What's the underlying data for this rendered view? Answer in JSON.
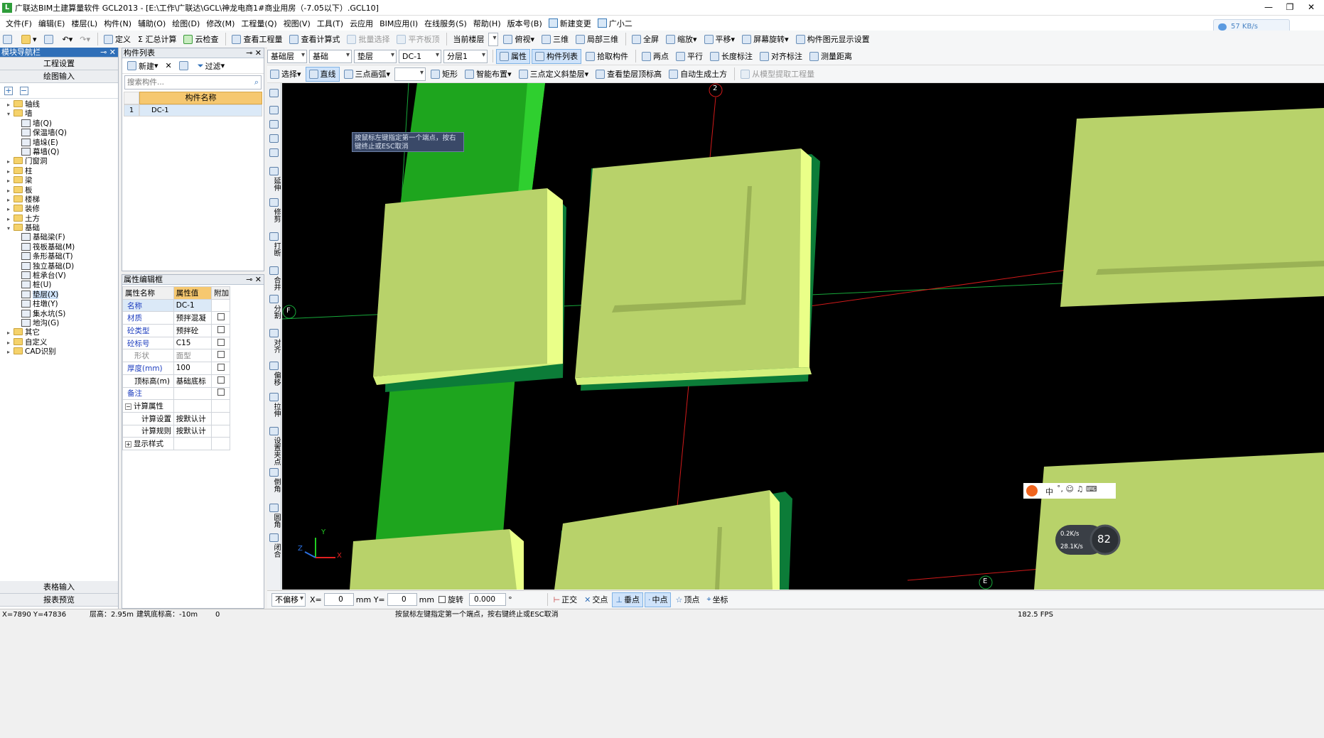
{
  "title": "广联达BIM土建算量软件 GCL2013 - [E:\\工作\\广联达\\GCL\\神龙电商1#商业用房（-7.05以下）.GCL10]",
  "menu": [
    "文件(F)",
    "编辑(E)",
    "楼层(L)",
    "构件(N)",
    "辅助(O)",
    "绘图(D)",
    "修改(M)",
    "工程量(Q)",
    "视图(V)",
    "工具(T)",
    "云应用",
    "BIM应用(I)",
    "在线服务(S)",
    "帮助(H)",
    "版本号(B)",
    "新建变更",
    "广小二"
  ],
  "net_speed": "57 KB/s",
  "toolbar1": {
    "define": "定义",
    "summary": "Σ 汇总计算",
    "cloud_check": "云检查",
    "view_qty": "查看工程量",
    "view_formula": "查看计算式",
    "batch_select": "批量选择",
    "level_slab": "平齐板顶",
    "current_floor": "当前楼层",
    "top_view": "俯视",
    "three_d": "三维",
    "local_3d": "局部三维",
    "fullscreen": "全屏",
    "zoom": "缩放",
    "pan": "平移",
    "rotate": "屏幕旋转",
    "display_settings": "构件图元显示设置"
  },
  "toolbar2": {
    "floor": "基础层",
    "category": "基础",
    "type": "垫层",
    "component": "DC-1",
    "layer": "分层1",
    "attributes": "属性",
    "comp_list": "构件列表",
    "pick": "拾取构件",
    "two_points": "两点",
    "parallel": "平行",
    "length_dim": "长度标注",
    "align_dim": "对齐标注",
    "measure": "测量距离"
  },
  "toolbar3": {
    "select": "选择",
    "line": "直线",
    "arc": "三点画弧",
    "rect": "矩形",
    "smart": "智能布置",
    "slope": "三点定义斜垫层",
    "view_elev": "查看垫层顶标高",
    "auto_earth": "自动生成土方",
    "from_model": "从模型提取工程量"
  },
  "nav": {
    "title": "模块导航栏",
    "project_settings": "工程设置",
    "drawing_input": "绘图输入",
    "table_input": "表格输入",
    "report_preview": "报表预览",
    "tree": [
      {
        "label": "轴线",
        "level": 0,
        "exp": "+",
        "kind": "fold"
      },
      {
        "label": "墙",
        "level": 0,
        "exp": "−",
        "kind": "fold"
      },
      {
        "label": "墙(Q)",
        "level": 1,
        "kind": "comp"
      },
      {
        "label": "保温墙(Q)",
        "level": 1,
        "kind": "comp"
      },
      {
        "label": "墙垛(E)",
        "level": 1,
        "kind": "comp"
      },
      {
        "label": "幕墙(Q)",
        "level": 1,
        "kind": "comp"
      },
      {
        "label": "门窗洞",
        "level": 0,
        "exp": "+",
        "kind": "fold"
      },
      {
        "label": "柱",
        "level": 0,
        "exp": "+",
        "kind": "fold"
      },
      {
        "label": "梁",
        "level": 0,
        "exp": "+",
        "kind": "fold"
      },
      {
        "label": "板",
        "level": 0,
        "exp": "+",
        "kind": "fold"
      },
      {
        "label": "楼梯",
        "level": 0,
        "exp": "+",
        "kind": "fold"
      },
      {
        "label": "装修",
        "level": 0,
        "exp": "+",
        "kind": "fold"
      },
      {
        "label": "土方",
        "level": 0,
        "exp": "+",
        "kind": "fold"
      },
      {
        "label": "基础",
        "level": 0,
        "exp": "−",
        "kind": "fold"
      },
      {
        "label": "基础梁(F)",
        "level": 1,
        "kind": "comp"
      },
      {
        "label": "筏板基础(M)",
        "level": 1,
        "kind": "comp"
      },
      {
        "label": "条形基础(T)",
        "level": 1,
        "kind": "comp"
      },
      {
        "label": "独立基础(D)",
        "level": 1,
        "kind": "comp"
      },
      {
        "label": "桩承台(V)",
        "level": 1,
        "kind": "comp"
      },
      {
        "label": "桩(U)",
        "level": 1,
        "kind": "comp"
      },
      {
        "label": "垫层(X)",
        "level": 1,
        "kind": "comp",
        "selected": true
      },
      {
        "label": "柱墩(Y)",
        "level": 1,
        "kind": "comp"
      },
      {
        "label": "集水坑(S)",
        "level": 1,
        "kind": "comp"
      },
      {
        "label": "地沟(G)",
        "level": 1,
        "kind": "comp"
      },
      {
        "label": "其它",
        "level": 0,
        "exp": "+",
        "kind": "fold"
      },
      {
        "label": "自定义",
        "level": 0,
        "exp": "+",
        "kind": "fold"
      },
      {
        "label": "CAD识别",
        "level": 0,
        "exp": "+",
        "kind": "fold"
      }
    ]
  },
  "complist": {
    "title": "构件列表",
    "new": "新建",
    "filter": "过滤",
    "search_placeholder": "搜索构件...",
    "col_name": "构件名称",
    "rows": [
      {
        "idx": "1",
        "name": "DC-1"
      }
    ]
  },
  "props": {
    "title": "属性编辑框",
    "col_name": "属性名称",
    "col_value": "属性值",
    "col_extra": "附加",
    "rows": [
      {
        "name": "名称",
        "value": "DC-1",
        "style": "blue",
        "chk": false
      },
      {
        "name": "材质",
        "value": "预拌混凝",
        "style": "blue",
        "chk": true
      },
      {
        "name": "砼类型",
        "value": "预拌砼",
        "style": "blue",
        "chk": true
      },
      {
        "name": "砼标号",
        "value": "C15",
        "style": "blue",
        "chk": true
      },
      {
        "name": "形状",
        "value": "面型",
        "style": "gray",
        "chk": true
      },
      {
        "name": "厚度(mm)",
        "value": "100",
        "style": "blue",
        "chk": true
      },
      {
        "name": "顶标高(m)",
        "value": "基础底标",
        "style": "black",
        "chk": true
      },
      {
        "name": "备注",
        "value": "",
        "style": "blue",
        "chk": true
      },
      {
        "name": "计算属性",
        "value": "",
        "style": "group",
        "exp": "−"
      },
      {
        "name": "计算设置",
        "value": "按默认计",
        "style": "sub"
      },
      {
        "name": "计算规则",
        "value": "按默认计",
        "style": "sub"
      },
      {
        "name": "显示样式",
        "value": "",
        "style": "group",
        "exp": "+"
      }
    ]
  },
  "vtools": [
    "延伸",
    "修剪",
    "打断",
    "合并",
    "分割",
    "对齐",
    "偏移",
    "拉伸",
    "设置夹点",
    "倒角",
    "圆角",
    "闭合"
  ],
  "viewport": {
    "tooltip_l1": "按鼠标左键指定第一个端点，按右",
    "tooltip_l2": "键终止或ESC取消",
    "axis_2": "2",
    "axis_f": "F",
    "axis_e": "E",
    "gizmo_x": "X",
    "gizmo_y": "Y",
    "gizmo_z": "Z",
    "ime": "中",
    "net_up": "0.2K/s",
    "net_down": "28.1K/s",
    "gauge": "82"
  },
  "snapbar": {
    "offset": "不偏移",
    "x_label": "X=",
    "x_val": "0",
    "y_label": "mm Y=",
    "y_val": "0",
    "unit": "mm",
    "rotate": "旋转",
    "rot_val": "0.000",
    "deg": "°",
    "ortho": "正交",
    "intersect": "交点",
    "perp": "垂点",
    "mid": "中点",
    "vertex": "顶点",
    "coord": "坐标"
  },
  "status": {
    "coords": "X=7890 Y=47836",
    "floor_h": "层高：2.95m",
    "base_elev": "建筑底标高：-10m",
    "zero": "0",
    "hint": "按鼠标左键指定第一个端点，按右键终止或ESC取消",
    "fps": "182.5 FPS"
  }
}
